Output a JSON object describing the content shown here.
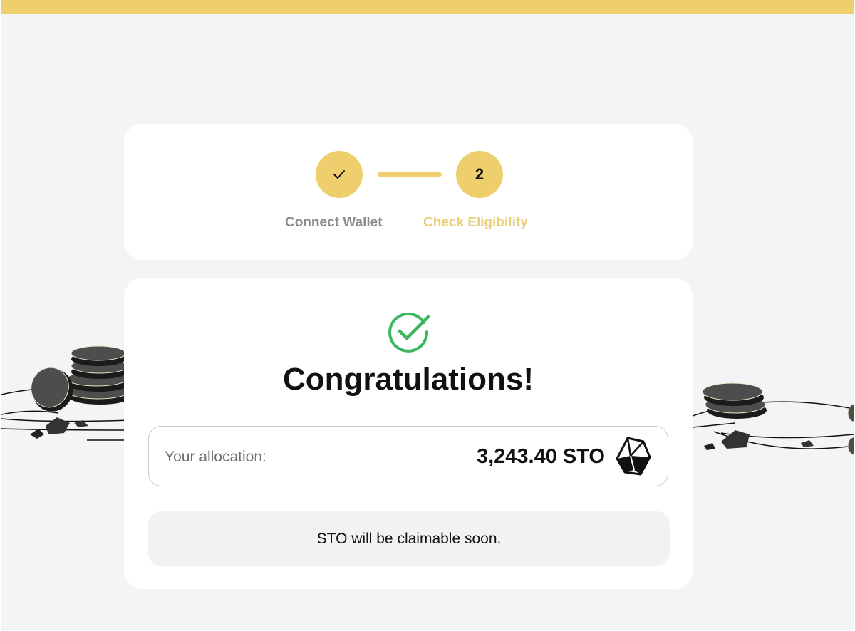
{
  "steps": {
    "items": [
      {
        "label": "Connect Wallet",
        "status": "complete",
        "marker": "check-icon"
      },
      {
        "label": "Check Eligibility",
        "status": "active",
        "marker": "2"
      }
    ]
  },
  "result": {
    "icon": "check-circle-icon",
    "title": "Congratulations!",
    "allocation": {
      "label": "Your allocation:",
      "value": "3,243.40 STO",
      "icon": "sto-token-icon"
    },
    "notice": "STO will be claimable soon."
  },
  "colors": {
    "accent": "#efcf6d",
    "accent_label": "#ead07c",
    "success": "#3cb660",
    "background": "#f2f4f5",
    "card": "#ffffff"
  }
}
